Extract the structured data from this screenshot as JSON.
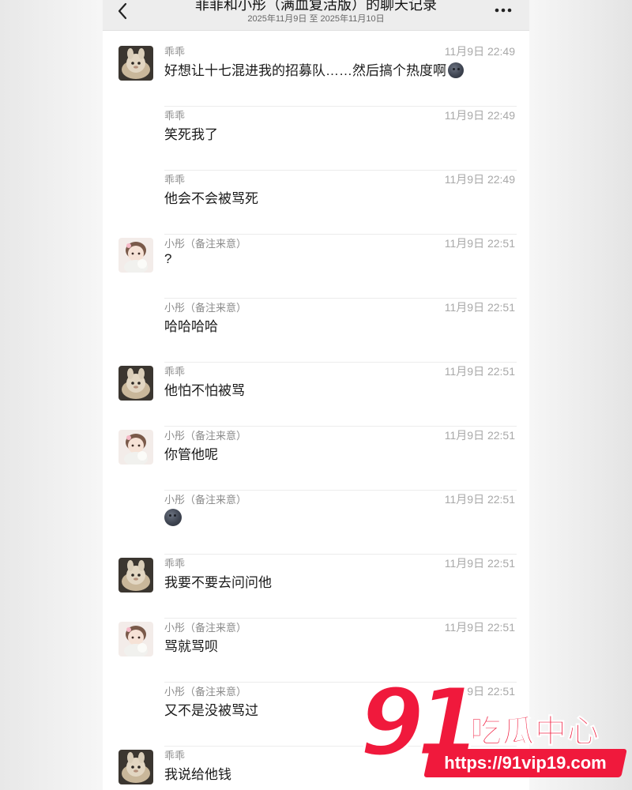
{
  "header": {
    "title": "菲菲和小彤（满血复活版）的聊天记录",
    "date_range": "2025年11月9日 至 2025年11月10日"
  },
  "colors": {
    "watermark_red": "#f0193c",
    "nav_background": "#ededed"
  },
  "messages": [
    {
      "sender": "乖乖",
      "time": "11月9日 22:49",
      "text": "好想让十七混进我的招募队……然后搞个热度啊",
      "emoji": "new-moon-face",
      "avatar": "avatar-guaiguai"
    },
    {
      "sender": "乖乖",
      "time": "11月9日 22:49",
      "text": "笑死我了"
    },
    {
      "sender": "乖乖",
      "time": "11月9日 22:49",
      "text": "他会不会被骂死"
    },
    {
      "sender": "小彤（备注来意）",
      "time": "11月9日 22:51",
      "text": "?",
      "avatar": "avatar-xiaotong"
    },
    {
      "sender": "小彤（备注来意）",
      "time": "11月9日 22:51",
      "text": "哈哈哈哈"
    },
    {
      "sender": "乖乖",
      "time": "11月9日 22:51",
      "text": "他怕不怕被骂",
      "avatar": "avatar-guaiguai"
    },
    {
      "sender": "小彤（备注来意）",
      "time": "11月9日 22:51",
      "text": "你管他呢",
      "avatar": "avatar-xiaotong"
    },
    {
      "sender": "小彤（备注来意）",
      "time": "11月9日 22:51",
      "emoji": "new-moon-face"
    },
    {
      "sender": "乖乖",
      "time": "11月9日 22:51",
      "text": "我要不要去问问他",
      "avatar": "avatar-guaiguai"
    },
    {
      "sender": "小彤（备注来意）",
      "time": "11月9日 22:51",
      "text": "骂就骂呗",
      "avatar": "avatar-xiaotong"
    },
    {
      "sender": "小彤（备注来意）",
      "time": "11月9日 22:51",
      "text": "又不是没被骂过"
    },
    {
      "sender": "乖乖",
      "text": "我说给他钱",
      "avatar": "avatar-guaiguai"
    }
  ],
  "watermark": {
    "number": "91",
    "name": "吃瓜中心",
    "url": "https://91vip19.com"
  }
}
